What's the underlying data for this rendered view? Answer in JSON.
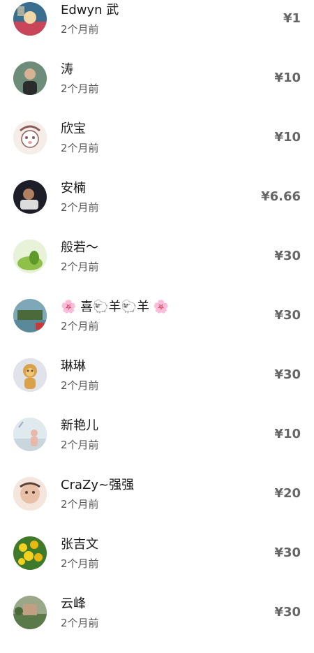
{
  "donors": [
    {
      "name": "Edwyn 武",
      "time": "2个月前",
      "amount": "¥1",
      "avatar_icon": "avatar-cartoon-scene-icon",
      "avatar_colors": [
        "#3a6e8f",
        "#c9455a",
        "#f1d7a6"
      ]
    },
    {
      "name": "涛",
      "time": "2个月前",
      "amount": "¥10",
      "avatar_icon": "avatar-man-portrait-icon",
      "avatar_colors": [
        "#6e8c7a",
        "#2b2b2b",
        "#d8b393"
      ]
    },
    {
      "name": "欣宝",
      "time": "2个月前",
      "amount": "¥10",
      "avatar_icon": "avatar-anime-girl-icon",
      "avatar_colors": [
        "#f4ede8",
        "#8a5a5a",
        "#e8a0a8"
      ]
    },
    {
      "name": "安楠",
      "time": "2个月前",
      "amount": "¥6.66",
      "avatar_icon": "avatar-dark-portrait-icon",
      "avatar_colors": [
        "#1e1e28",
        "#dcdcdc",
        "#b08060"
      ]
    },
    {
      "name": "般若～",
      "time": "2个月前",
      "amount": "¥30",
      "avatar_icon": "avatar-green-pear-icon",
      "avatar_colors": [
        "#e8f2d8",
        "#8fc04a",
        "#5e9a2a"
      ]
    },
    {
      "name": "🌸 喜🐑羊🐑羊 🌸",
      "time": "2个月前",
      "amount": "¥30",
      "avatar_icon": "avatar-riverside-building-icon",
      "avatar_colors": [
        "#7ea8b8",
        "#4a6a3a",
        "#c83a3a"
      ]
    },
    {
      "name": "琳琳",
      "time": "2个月前",
      "amount": "¥30",
      "avatar_icon": "avatar-stuffed-lion-icon",
      "avatar_colors": [
        "#e0e4ea",
        "#d9a24a",
        "#6a5040"
      ]
    },
    {
      "name": "新艳儿",
      "time": "2个月前",
      "amount": "¥10",
      "avatar_icon": "avatar-woman-seaside-icon",
      "avatar_colors": [
        "#dfe9ee",
        "#c9d6de",
        "#e8b8a8"
      ]
    },
    {
      "name": "CraZy~强强",
      "time": "2个月前",
      "amount": "¥20",
      "avatar_icon": "avatar-baby-photo-icon",
      "avatar_colors": [
        "#f4e6dc",
        "#e8c0a8",
        "#5a4034"
      ]
    },
    {
      "name": "张吉文",
      "time": "2个月前",
      "amount": "¥30",
      "avatar_icon": "avatar-yellow-flowers-icon",
      "avatar_colors": [
        "#3e7a2a",
        "#f2d21e",
        "#e8b810"
      ]
    },
    {
      "name": "云峰",
      "time": "2个月前",
      "amount": "¥30",
      "avatar_icon": "avatar-garden-landscape-icon",
      "avatar_colors": [
        "#9aa88a",
        "#5a7a4a",
        "#c0a080"
      ]
    }
  ]
}
